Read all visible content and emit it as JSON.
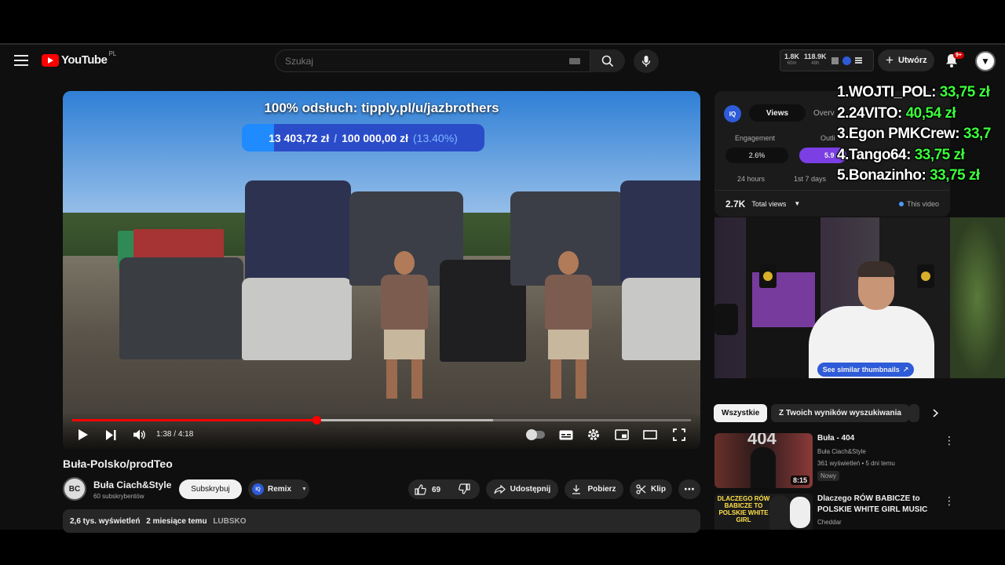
{
  "header": {
    "logo_text": "YouTube",
    "logo_country": "PL",
    "search_placeholder": "Szukaj",
    "stats": [
      {
        "value": "1.8K",
        "label": "60m"
      },
      {
        "value": "118.9K",
        "label": "48h"
      }
    ],
    "create_label": "Utwórz",
    "notification_count": "9+"
  },
  "player": {
    "donation_title": "100% odsłuch: tipply.pl/u/jazbrothers",
    "donation_current": "13 403,72 zł",
    "donation_separator": "/",
    "donation_goal": "100 000,00 zł",
    "donation_percent": "(13.40%)",
    "donation_fraction": 0.134,
    "time_current": "1:38",
    "time_separator": "/",
    "time_total": "4:18",
    "played_fraction": 0.395,
    "buffered_fraction": 0.68
  },
  "video": {
    "title": "Buła-Polsko/prodTeo",
    "channel_name": "Buła Ciach&Style",
    "channel_subs": "60 subskrybentów",
    "subscribe_label": "Subskrybuj",
    "remix_label": "Remix",
    "likes": "69",
    "share_label": "Udostępnij",
    "download_label": "Pobierz",
    "clip_label": "Klip",
    "views": "2,6 tys. wyświetleń",
    "date": "2 miesiące temu",
    "tag": "LUBSKO"
  },
  "iq_panel": {
    "logo": "IQ",
    "tab_views": "Views",
    "tab_overview": "Overv",
    "label_engagement": "Engagement",
    "label_outlier": "Outli",
    "engagement_value": "2.6%",
    "outlier_value": "5.9",
    "label_24h": "24 hours",
    "label_first7": "1st 7 days",
    "total_views": "2.7K",
    "total_views_label": "Total views",
    "this_video_label": "This video",
    "similar_btn": "See similar thumbnails"
  },
  "leaderboard": [
    {
      "rank": "1.",
      "name": "WOJTI_POL:",
      "amount": "33,75 zł"
    },
    {
      "rank": "2.",
      "name": "24VITO:",
      "amount": "40,54 zł"
    },
    {
      "rank": "3.",
      "name": "Egon PMKCrew:",
      "amount": "33,7"
    },
    {
      "rank": "4.",
      "name": "Tango64:",
      "amount": "33,75 zł"
    },
    {
      "rank": "5.",
      "name": "Bonazinho:",
      "amount": "33,75 zł"
    }
  ],
  "chips": [
    {
      "label": "Wszystkie"
    },
    {
      "label": "Z Twoich wyników wyszukiwania"
    }
  ],
  "recommendations": [
    {
      "thumb_text": "404",
      "title": "Buła - 404",
      "channel": "Buła Ciach&Style",
      "meta": "361 wyświetleń • 5 dni temu",
      "badge": "Nowy",
      "duration": "8:15"
    },
    {
      "thumb_text": "DLACZEGO RÓW BABICZE TO POLSKIE WHITE GIRL",
      "title": "Dlaczego RÓW BABICZE to POLSKIE WHITE GIRL MUSIC",
      "channel": "Cheddar"
    }
  ],
  "colors": {
    "accent_red": "#ff0000",
    "iq_blue": "#2e5bd8",
    "leaderboard_green": "#3cff3c"
  }
}
